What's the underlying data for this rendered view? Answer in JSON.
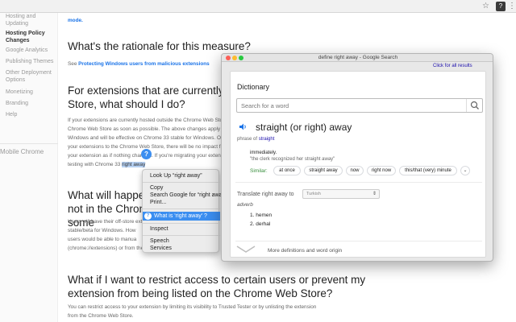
{
  "browser": {
    "ext_badge": "?"
  },
  "sidebar": {
    "items": [
      {
        "label": "Hosting and Updating",
        "active": false
      },
      {
        "label": "Hosting Policy Changes",
        "active": true
      },
      {
        "label": "Google Analytics",
        "active": false
      },
      {
        "label": "Publishing Themes",
        "active": false
      },
      {
        "label": "Other Deployment Options",
        "active": false
      },
      {
        "label": "Monetizing",
        "active": false
      },
      {
        "label": "Branding",
        "active": false
      },
      {
        "label": "Help",
        "active": false
      }
    ],
    "footer": "Mobile Chrome"
  },
  "article": {
    "top_fragment": "mode.",
    "h1": "What's the rationale for this measure?",
    "p1_prefix": "See ",
    "p1_link": "Protecting Windows users from malicious extensions",
    "h2": "For extensions that are currently hosted outside the Chrome Web Store, what should I do?",
    "p2_lines": [
      "If your extensions are currently hosted outside the Chrome Web Store, you should",
      "Chrome Web Store as soon as possible. The above changes apply to",
      "Windows and will be effective on Chrome 33 stable for Windows. Once",
      "your extensions to the Chrome Web Store, there will be no impact for",
      "your extension as if nothing changed. If you're migrating your extension,",
      "testing with Chrome 33"
    ],
    "p2_selected": "right away",
    "h3": "What will happen to extensions not in the Chrome Web Store some",
    "p3_lines": [
      "Users will have their off-store extensions disabled",
      "stable/beta for Windows. How",
      "users would be able to manua",
      "(chrome://extensions) or from the Chrome Web Store listing."
    ],
    "h4": "What if I want to restrict access to certain users or prevent my extension from being listed on the Chrome Web Store?",
    "p4_lines": [
      "You can restrict access to your extension by limiting its visibility to Trusted Tester or by unlisting the extension",
      "from the Chrome Web Store."
    ]
  },
  "context_menu": {
    "look_up": "Look Up “right away”",
    "copy": "Copy",
    "search_google": "Search Google for “right away”",
    "print": "Print...",
    "what_is": "What is ‘right away’ ?",
    "inspect": "Inspect",
    "speech": "Speech",
    "services": "Services",
    "badge": "?"
  },
  "popup": {
    "title": "define right away - Google Search",
    "click_all": "Click for all results",
    "heading": "Dictionary",
    "search_placeholder": "Search for a word",
    "word": "straight (or right) away",
    "phrase_of_label": "phrase of ",
    "phrase_of_link": "straight",
    "definition": "immediately.",
    "example": "\"the clerk recognized her straight away\"",
    "similar_label": "Similar:",
    "similar": [
      "at once",
      "straight away",
      "now",
      "right now",
      "this/that (very) minute"
    ],
    "translate_label": "Translate right away to",
    "translate_lang": "Turkish",
    "adverb": "adverb",
    "translations": [
      "1.  hemen",
      "2.  derhal"
    ],
    "more": "More definitions and word origin"
  },
  "colors": {
    "link": "#1a73e8",
    "selection": "#b5d0f2",
    "menu_highlight": "#3b8ef0",
    "similar_green": "#388e3c"
  },
  "icons": [
    "star-icon",
    "extension-icon",
    "menu-icon",
    "search-icon",
    "speaker-icon",
    "chevron-down-icon"
  ]
}
